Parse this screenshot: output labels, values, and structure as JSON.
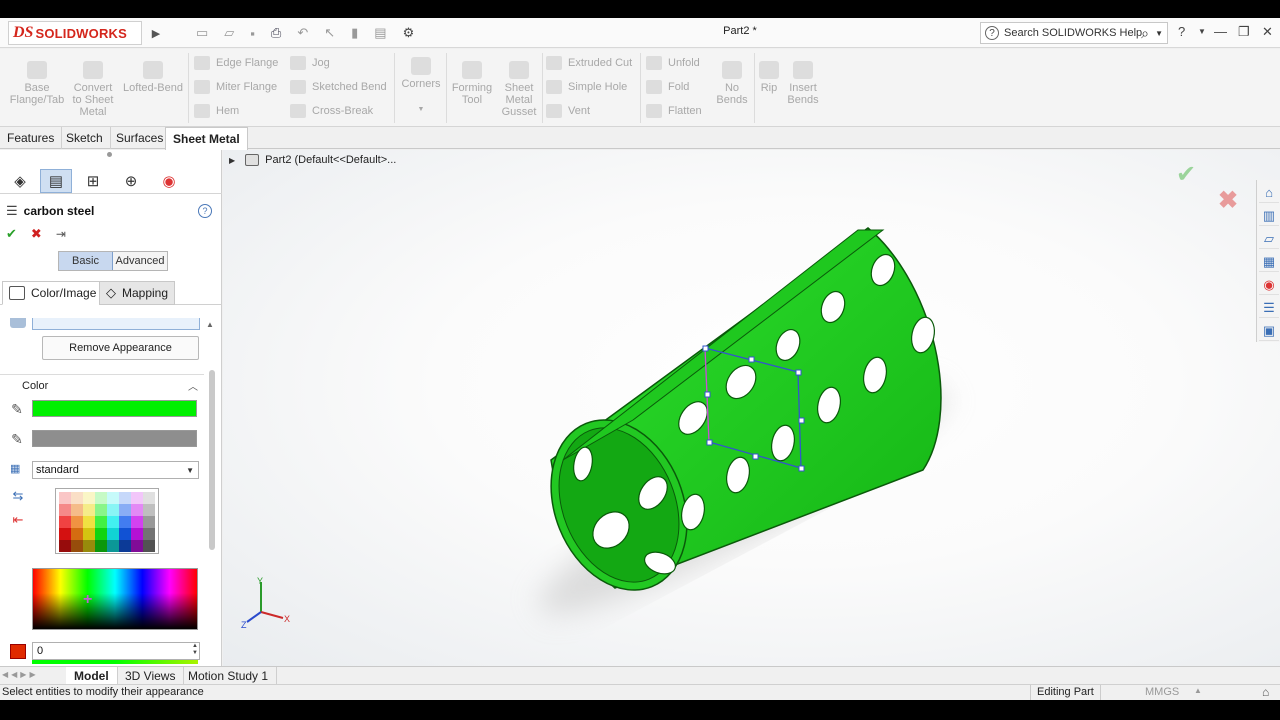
{
  "app": {
    "brand_mark": "DS",
    "brand_name": "SOLIDWORKS",
    "document_title": "Part2 *",
    "help_search_placeholder": "Search SOLIDWORKS Help"
  },
  "command_manager": {
    "large_buttons": [
      {
        "label": "Base Flange/Tab"
      },
      {
        "label": "Convert to Sheet Metal"
      },
      {
        "label": "Lofted-Bend"
      },
      {
        "label": "Corners"
      },
      {
        "label": "Forming Tool"
      },
      {
        "label": "Sheet Metal Gusset"
      },
      {
        "label": "No Bends"
      },
      {
        "label": "Rip"
      },
      {
        "label": "Insert Bends"
      }
    ],
    "small_buttons": [
      {
        "label": "Edge Flange"
      },
      {
        "label": "Miter Flange"
      },
      {
        "label": "Hem"
      },
      {
        "label": "Jog"
      },
      {
        "label": "Sketched Bend"
      },
      {
        "label": "Cross-Break"
      },
      {
        "label": "Extruded Cut"
      },
      {
        "label": "Simple Hole"
      },
      {
        "label": "Vent"
      },
      {
        "label": "Unfold"
      },
      {
        "label": "Fold"
      },
      {
        "label": "Flatten"
      }
    ]
  },
  "tabs": [
    {
      "label": "Features"
    },
    {
      "label": "Sketch"
    },
    {
      "label": "Surfaces"
    },
    {
      "label": "Sheet Metal",
      "active": true
    }
  ],
  "property_manager": {
    "title": "carbon steel",
    "mode_tabs": [
      "Basic",
      "Advanced"
    ],
    "active_mode": "Basic",
    "sub_tabs": [
      "Color/Image",
      "Mapping"
    ],
    "remove_button": "Remove Appearance",
    "color_section_label": "Color",
    "primary_color": "#00f000",
    "secondary_color": "#8e8e8e",
    "palette_dropdown": "standard",
    "value_field": "0",
    "value_chip_color": "#e02a00"
  },
  "graphics": {
    "tree_root": "Part2  (Default<<Default>...",
    "triad_labels": [
      "Y",
      "X",
      "Z"
    ],
    "model_color": "#1ed21e"
  },
  "bottom_tabs": [
    "Model",
    "3D Views",
    "Motion Study 1"
  ],
  "status": {
    "message": "Select entities to modify their appearance",
    "mode": "Editing Part",
    "units": "MMGS"
  }
}
